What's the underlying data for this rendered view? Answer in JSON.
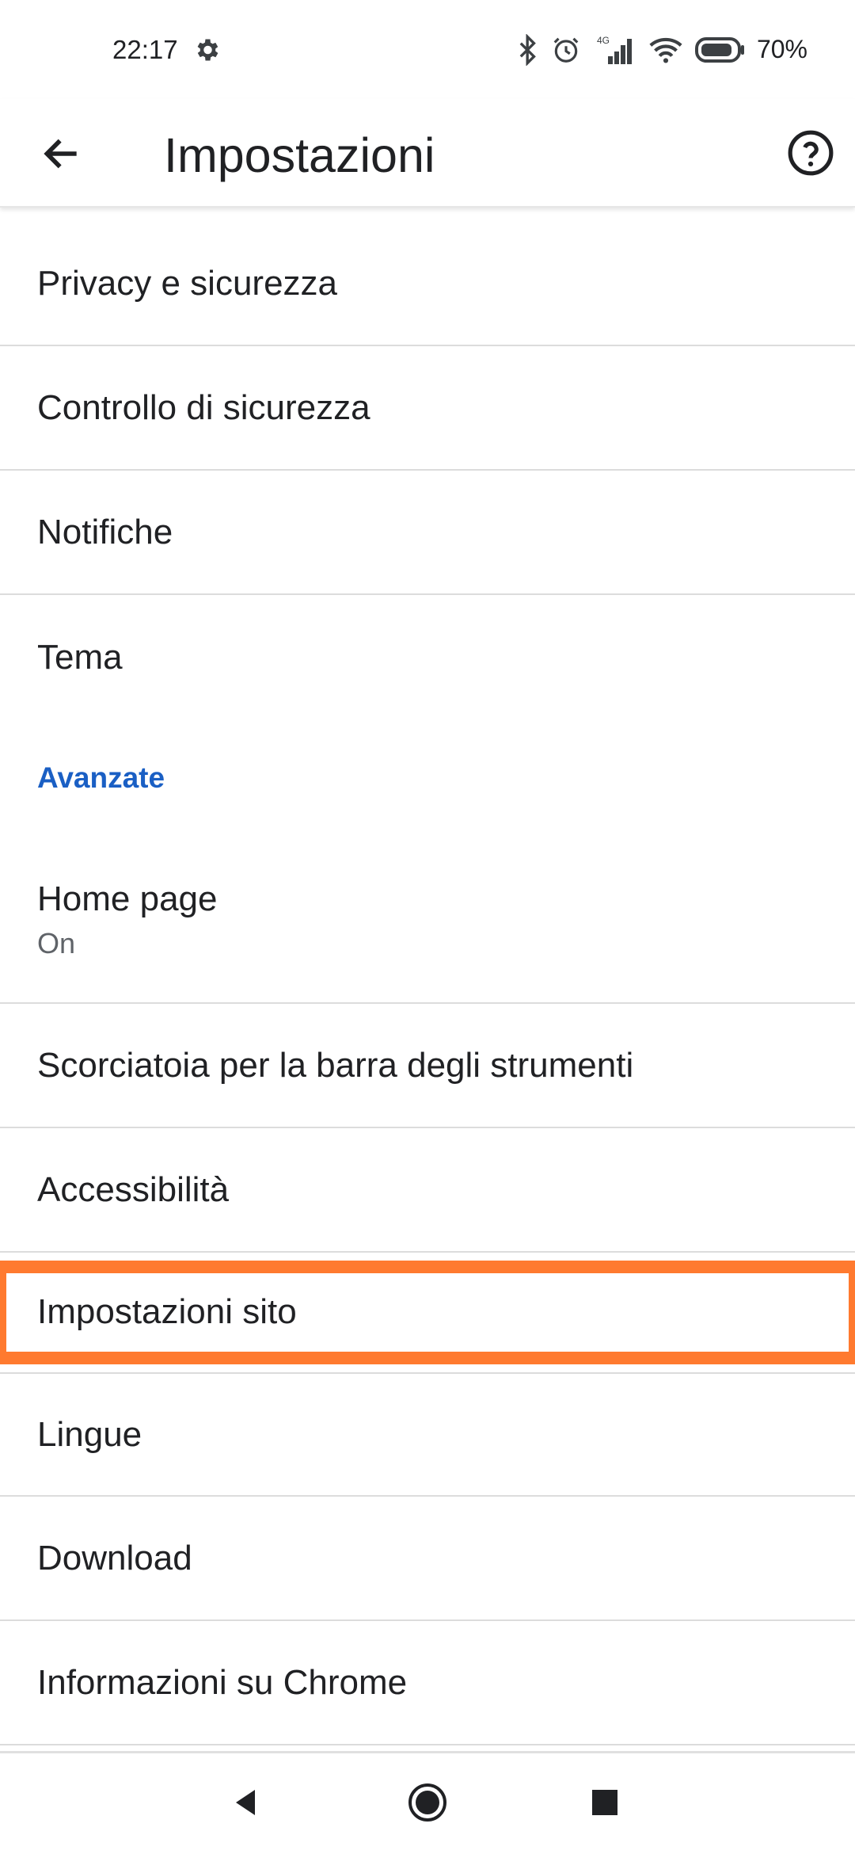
{
  "status_bar": {
    "time": "22:17",
    "battery_percent": "70%",
    "network_label": "4G",
    "icons": [
      "gear-icon",
      "bluetooth-icon",
      "alarm-icon",
      "signal-icon",
      "wifi-icon",
      "battery-icon"
    ]
  },
  "app_bar": {
    "title": "Impostazioni",
    "back_icon": "arrow-left-icon",
    "help_icon": "help-circle-icon"
  },
  "settings": {
    "items_top": [
      {
        "label": "Privacy e sicurezza"
      },
      {
        "label": "Controllo di sicurezza"
      },
      {
        "label": "Notifiche"
      },
      {
        "label": "Tema"
      }
    ],
    "section_advanced": "Avanzate",
    "homepage": {
      "label": "Home page",
      "value": "On"
    },
    "items_bottom": [
      {
        "label": "Scorciatoia per la barra degli strumenti"
      },
      {
        "label": "Accessibilità"
      },
      {
        "label": "Impostazioni sito"
      },
      {
        "label": "Lingue"
      },
      {
        "label": "Download"
      },
      {
        "label": "Informazioni su Chrome"
      }
    ],
    "highlight_color": "#ff7a2f",
    "section_color": "#1a5fc4"
  },
  "nav_bar": {
    "icons": [
      "back-triangle-icon",
      "home-circle-icon",
      "recents-square-icon"
    ]
  }
}
